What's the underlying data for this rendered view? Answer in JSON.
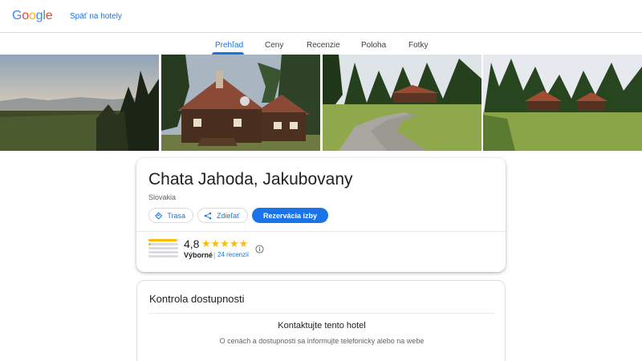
{
  "header": {
    "logo_letters": [
      "G",
      "o",
      "o",
      "g",
      "l",
      "e"
    ],
    "back_link": "Späť na hotely"
  },
  "tabs": [
    {
      "label": "Prehľad",
      "active": true
    },
    {
      "label": "Ceny",
      "active": false
    },
    {
      "label": "Recenzie",
      "active": false
    },
    {
      "label": "Poloha",
      "active": false
    },
    {
      "label": "Fotky",
      "active": false
    }
  ],
  "gallery": {
    "photos": [
      "sunset-meadow",
      "wooden-chalet-closeup",
      "gravel-road-chalet",
      "chalet-meadow-distance"
    ]
  },
  "hotel": {
    "name": "Chata Jahoda, Jakubovany",
    "country": "Slovakia",
    "actions": {
      "directions": "Trasa",
      "share": "Zdieľať",
      "book": "Rezervácia izby"
    },
    "rating": {
      "score": "4,8",
      "stars": "★★★★★",
      "label": "Výborné",
      "separator": "|",
      "reviews": "24 recenzií",
      "distribution": [
        0.95,
        0.08,
        0.0,
        0.0,
        0.0
      ]
    }
  },
  "availability": {
    "title": "Kontrola dostupnosti",
    "contact": "Kontaktujte tento hotel",
    "info": "O cenách a dostupnosti sa informujte telefonicky alebo na webe"
  },
  "colors": {
    "accent": "#1a73e8",
    "star": "#fbbc04",
    "divider": "#dadce0"
  }
}
